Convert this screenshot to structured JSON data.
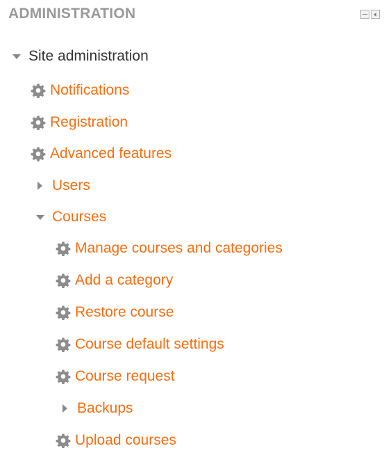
{
  "block": {
    "title": "ADMINISTRATION",
    "hide_icon": "minus-icon",
    "dock_icon": "dock-icon"
  },
  "tree": {
    "root_label": "Site administration",
    "items": [
      {
        "label": "Notifications",
        "icon": "gear-icon"
      },
      {
        "label": "Registration",
        "icon": "gear-icon"
      },
      {
        "label": "Advanced features",
        "icon": "gear-icon"
      },
      {
        "label": "Users",
        "icon": "chevron-right-icon"
      },
      {
        "label": "Courses",
        "icon": "chevron-down-icon"
      }
    ],
    "courses_items": [
      {
        "label": "Manage courses and categories",
        "icon": "gear-icon"
      },
      {
        "label": "Add a category",
        "icon": "gear-icon"
      },
      {
        "label": "Restore course",
        "icon": "gear-icon"
      },
      {
        "label": "Course default settings",
        "icon": "gear-icon"
      },
      {
        "label": "Course request",
        "icon": "gear-icon"
      },
      {
        "label": "Backups",
        "icon": "chevron-right-icon"
      },
      {
        "label": "Upload courses",
        "icon": "gear-icon"
      }
    ]
  },
  "colors": {
    "link": "#f96d0e",
    "heading": "#999999",
    "text": "#333333",
    "icon": "#888888"
  }
}
